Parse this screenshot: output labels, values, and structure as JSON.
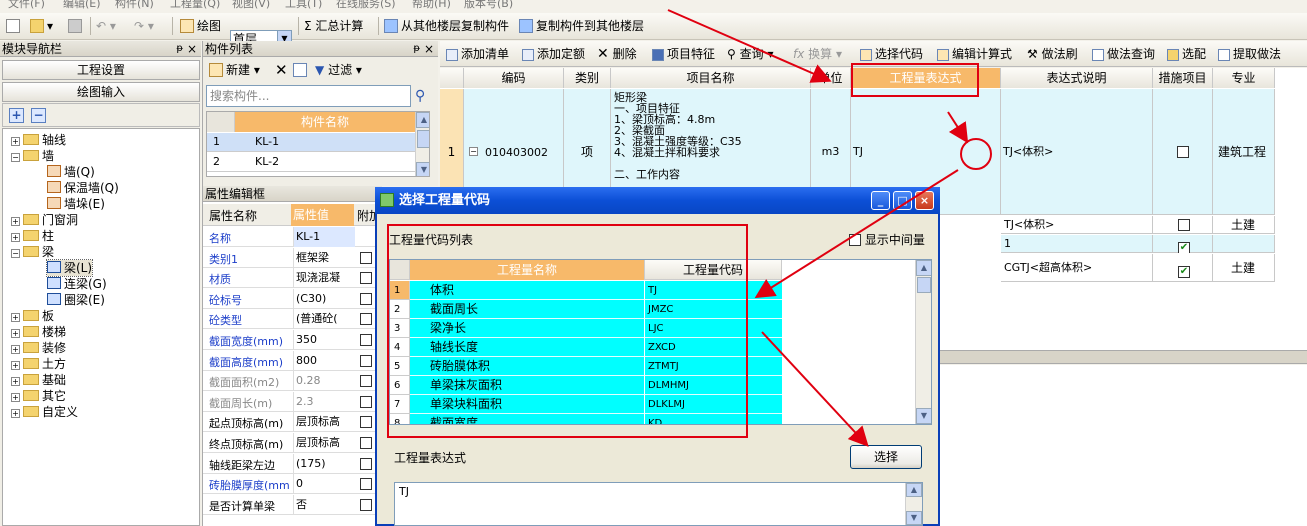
{
  "menubar": [
    "文件(F)",
    "编辑(E)",
    "构件(N)",
    "工程量(Q)",
    "视图(V)",
    "工具(T)",
    "在线服务(S)",
    "帮助(H)",
    "版本号(B)"
  ],
  "toolbar": {
    "draw": "绘图",
    "floor": "首层",
    "sum": "Σ 汇总计算",
    "copy_from": "从其他楼层复制构件",
    "copy_to": "复制构件到其他楼层"
  },
  "nav": {
    "title": "模块导航栏",
    "pin": "ᵽ",
    "close": "×",
    "project_settings": "工程设置",
    "drawing_input": "绘图输入",
    "add": "+",
    "remove": "−",
    "tree": [
      {
        "label": "轴线",
        "expand": "+",
        "level": 0
      },
      {
        "label": "墙",
        "expand": "−",
        "level": 0
      },
      {
        "label": "墙(Q)",
        "level": 1
      },
      {
        "label": "保温墙(Q)",
        "level": 1
      },
      {
        "label": "墙垛(E)",
        "level": 1
      },
      {
        "label": "门窗洞",
        "expand": "+",
        "level": 0
      },
      {
        "label": "柱",
        "expand": "+",
        "level": 0
      },
      {
        "label": "梁",
        "expand": "−",
        "level": 0
      },
      {
        "label": "梁(L)",
        "level": 1
      },
      {
        "label": "连梁(G)",
        "level": 1
      },
      {
        "label": "圈梁(E)",
        "level": 1
      },
      {
        "label": "板",
        "expand": "+",
        "level": 0
      },
      {
        "label": "楼梯",
        "expand": "+",
        "level": 0
      },
      {
        "label": "装修",
        "expand": "+",
        "level": 0
      },
      {
        "label": "土方",
        "expand": "+",
        "level": 0
      },
      {
        "label": "基础",
        "expand": "+",
        "level": 0
      },
      {
        "label": "其它",
        "expand": "+",
        "level": 0
      },
      {
        "label": "自定义",
        "expand": "+",
        "level": 0
      }
    ]
  },
  "component_list": {
    "title": "构件列表",
    "pin": "ᵽ",
    "close": "×",
    "new": "新建",
    "filter": "过滤",
    "search_placeholder": "搜索构件...",
    "header": "构件名称",
    "rows": [
      {
        "num": "1",
        "name": "KL-1"
      },
      {
        "num": "2",
        "name": "KL-2"
      }
    ]
  },
  "properties": {
    "title": "属性编辑框",
    "headers": [
      "属性名称",
      "属性值",
      "附加"
    ],
    "rows": [
      {
        "name": "名称",
        "value": "KL-1",
        "blue": true,
        "check": false
      },
      {
        "name": "类别1",
        "value": "框架梁",
        "blue": true,
        "check": true
      },
      {
        "name": "材质",
        "value": "现浇混凝",
        "blue": true,
        "check": true
      },
      {
        "name": "砼标号",
        "value": "(C30)",
        "blue": true,
        "check": true
      },
      {
        "name": "砼类型",
        "value": "(普通砼(",
        "blue": true,
        "check": true
      },
      {
        "name": "截面宽度(mm)",
        "value": "350",
        "blue": true,
        "check": true
      },
      {
        "name": "截面高度(mm)",
        "value": "800",
        "blue": true,
        "check": true
      },
      {
        "name": "截面面积(m2)",
        "value": "0.28",
        "blue": false,
        "gray": true,
        "check": true
      },
      {
        "name": "截面周长(m)",
        "value": "2.3",
        "blue": false,
        "gray": true,
        "check": true
      },
      {
        "name": "起点顶标高(m)",
        "value": "层顶标高",
        "blue": false,
        "check": true
      },
      {
        "name": "终点顶标高(m)",
        "value": "层顶标高",
        "blue": false,
        "check": true
      },
      {
        "name": "轴线距梁左边",
        "value": "(175)",
        "blue": false,
        "check": true
      },
      {
        "name": "砖胎膜厚度(mm",
        "value": "0",
        "blue": true,
        "check": true
      },
      {
        "name": "是否计算单梁",
        "value": "否",
        "blue": false,
        "check": true
      }
    ]
  },
  "right_toolbar": {
    "add_list": "添加清单",
    "add_quota": "添加定额",
    "delete": "删除",
    "feature": "项目特征",
    "query": "查询",
    "convert": "换算",
    "select_code": "选择代码",
    "edit_formula": "编辑计算式",
    "brush": "做法刷",
    "method_query": "做法查询",
    "select_match": "选配",
    "extract": "提取做法"
  },
  "main_grid": {
    "headers": [
      "编码",
      "类别",
      "项目名称",
      "单位",
      "工程量表达式",
      "表达式说明",
      "措施项目",
      "专业"
    ],
    "row1": {
      "num": "1",
      "expand": "−",
      "code": "010403002",
      "type": "项",
      "name_lines": [
        "矩形梁",
        "一、项目特征",
        "1、梁顶标高：4.8m",
        "2、梁截面",
        "3、混凝土强度等级：C35",
        "4、混凝土拌和料要求",
        "",
        "二、工作内容"
      ],
      "unit": "m3",
      "expr": "TJ",
      "desc": "TJ<体积>",
      "measure": false,
      "major": "建筑工程"
    },
    "row2": {
      "desc": "TJ<体积>",
      "measure": false,
      "major": "土建"
    },
    "row3": {
      "desc": "1",
      "measure": true,
      "major": ""
    },
    "row4": {
      "desc": "CGTJ<超高体积>",
      "measure": true,
      "major": "土建"
    }
  },
  "dialog": {
    "title": "选择工程量代码",
    "list_label": "工程量代码列表",
    "show_mid": "显示中间量",
    "col_name": "工程量名称",
    "col_code": "工程量代码",
    "rows": [
      {
        "num": "1",
        "name": "体积",
        "code": "TJ"
      },
      {
        "num": "2",
        "name": "截面周长",
        "code": "JMZC"
      },
      {
        "num": "3",
        "name": "梁净长",
        "code": "LJC"
      },
      {
        "num": "4",
        "name": "轴线长度",
        "code": "ZXCD"
      },
      {
        "num": "5",
        "name": "砖胎膜体积",
        "code": "ZTMTJ"
      },
      {
        "num": "6",
        "name": "单梁抹灰面积",
        "code": "DLMHMJ"
      },
      {
        "num": "7",
        "name": "单梁块料面积",
        "code": "DLKLMJ"
      },
      {
        "num": "8",
        "name": "截面宽度",
        "code": "KD"
      }
    ],
    "expr_label": "工程量表达式",
    "select_button": "选择",
    "expr_value": "TJ",
    "min": "_",
    "max": "□",
    "close": "×"
  },
  "colors": {
    "accent": "#0a3fb8",
    "highlight": "#00ffff",
    "annotation": "#e00010",
    "header_orange": "#f7b96a"
  }
}
